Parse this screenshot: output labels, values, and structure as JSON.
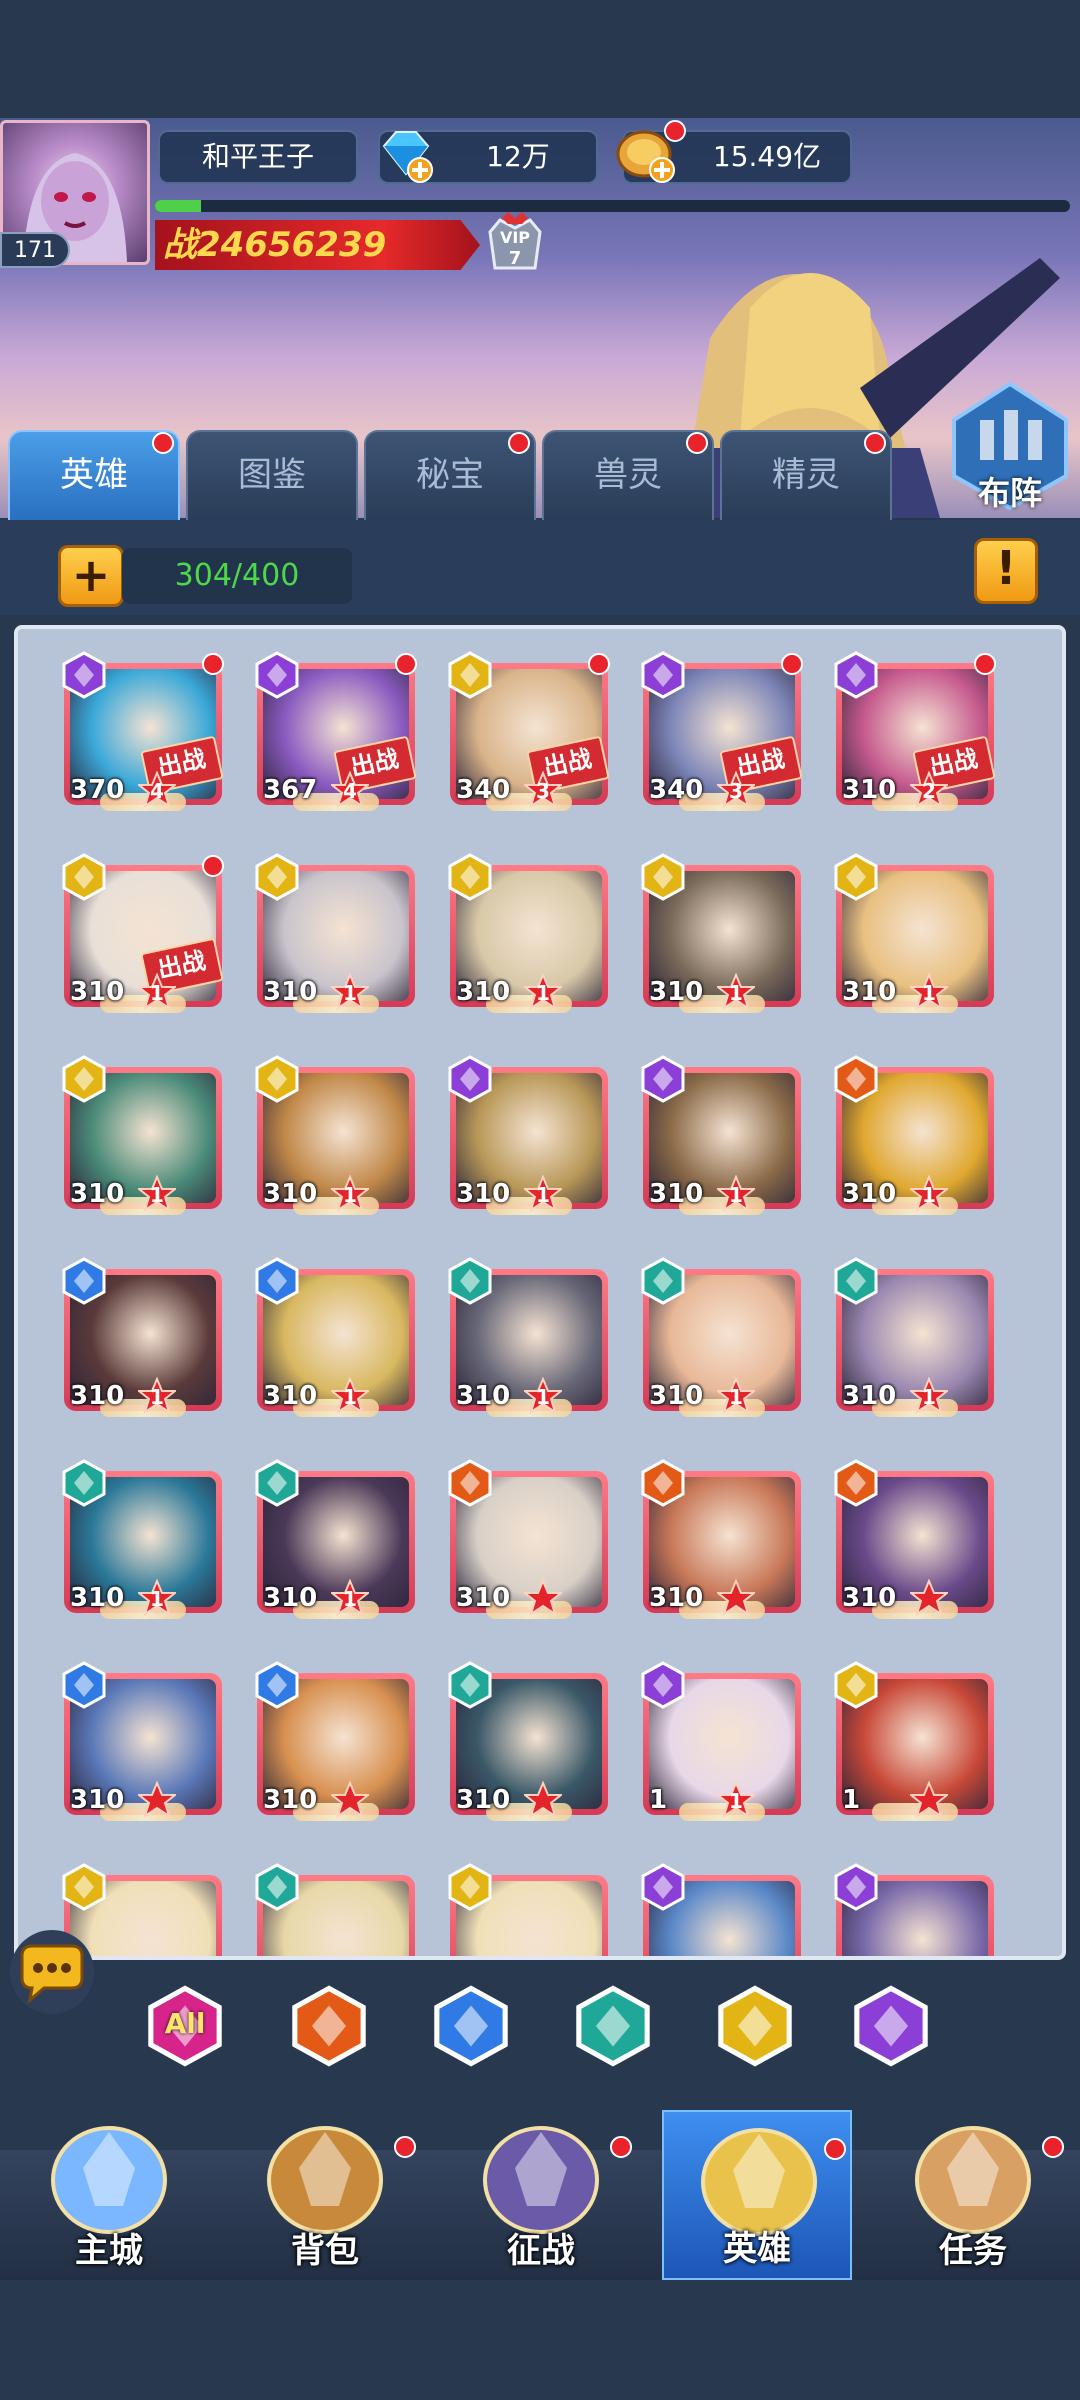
{
  "player": {
    "name": "和平王子",
    "level": "171",
    "gems": "12万",
    "gold": "15.49亿",
    "power": "24656239",
    "power_prefix": "战",
    "vip": "7",
    "vip_label": "VIP",
    "xp_progress": 0.05
  },
  "tabs": [
    {
      "label": "英雄",
      "active": true,
      "dot": true
    },
    {
      "label": "图鉴",
      "active": false,
      "dot": false
    },
    {
      "label": "秘宝",
      "active": false,
      "dot": true
    },
    {
      "label": "兽灵",
      "active": false,
      "dot": true
    },
    {
      "label": "精灵",
      "active": false,
      "dot": true
    }
  ],
  "formation_label": "布阵",
  "capacity": "304/400",
  "deploy_label": "出战",
  "heroes": [
    {
      "level": "370",
      "stars": "4",
      "element": "purple",
      "deployed": true,
      "dot": true,
      "hue": "#3aa8d8"
    },
    {
      "level": "367",
      "stars": "4",
      "element": "purple",
      "deployed": true,
      "dot": true,
      "hue": "#8a5bc0"
    },
    {
      "level": "340",
      "stars": "3",
      "element": "yellow",
      "deployed": true,
      "dot": true,
      "hue": "#d9b48a"
    },
    {
      "level": "340",
      "stars": "3",
      "element": "purple",
      "deployed": true,
      "dot": true,
      "hue": "#7d86b8"
    },
    {
      "level": "310",
      "stars": "2",
      "element": "purple",
      "deployed": true,
      "dot": true,
      "hue": "#c65a8e"
    },
    {
      "level": "310",
      "stars": "1",
      "element": "yellow",
      "deployed": true,
      "dot": true,
      "hue": "#e8e0d8"
    },
    {
      "level": "310",
      "stars": "1",
      "element": "yellow",
      "deployed": false,
      "dot": false,
      "hue": "#c9c4cc"
    },
    {
      "level": "310",
      "stars": "1",
      "element": "yellow",
      "deployed": false,
      "dot": false,
      "hue": "#d8c8a8"
    },
    {
      "level": "310",
      "stars": "1",
      "element": "yellow",
      "deployed": false,
      "dot": false,
      "hue": "#7a6a5a"
    },
    {
      "level": "310",
      "stars": "1",
      "element": "yellow",
      "deployed": false,
      "dot": false,
      "hue": "#e8c080"
    },
    {
      "level": "310",
      "stars": "1",
      "element": "yellow",
      "deployed": false,
      "dot": false,
      "hue": "#4a8a78"
    },
    {
      "level": "310",
      "stars": "1",
      "element": "yellow",
      "deployed": false,
      "dot": false,
      "hue": "#c08848"
    },
    {
      "level": "310",
      "stars": "1",
      "element": "purple",
      "deployed": false,
      "dot": false,
      "hue": "#b89858"
    },
    {
      "level": "310",
      "stars": "1",
      "element": "purple",
      "deployed": false,
      "dot": false,
      "hue": "#8a6a48"
    },
    {
      "level": "310",
      "stars": "1",
      "element": "orange",
      "deployed": false,
      "dot": false,
      "hue": "#e0a830"
    },
    {
      "level": "310",
      "stars": "1",
      "element": "blue",
      "deployed": false,
      "dot": false,
      "hue": "#5a3a3a"
    },
    {
      "level": "310",
      "stars": "1",
      "element": "blue",
      "deployed": false,
      "dot": false,
      "hue": "#d8b860"
    },
    {
      "level": "310",
      "stars": "1",
      "element": "teal",
      "deployed": false,
      "dot": false,
      "hue": "#686878"
    },
    {
      "level": "310",
      "stars": "1",
      "element": "teal",
      "deployed": false,
      "dot": false,
      "hue": "#e8b898"
    },
    {
      "level": "310",
      "stars": "1",
      "element": "teal",
      "deployed": false,
      "dot": false,
      "hue": "#9a88b0"
    },
    {
      "level": "310",
      "stars": "1",
      "element": "teal",
      "deployed": false,
      "dot": false,
      "hue": "#2a7898"
    },
    {
      "level": "310",
      "stars": "1",
      "element": "teal",
      "deployed": false,
      "dot": false,
      "hue": "#4a3858"
    },
    {
      "level": "310",
      "stars": "",
      "element": "orange",
      "deployed": false,
      "dot": false,
      "hue": "#d8d0c8"
    },
    {
      "level": "310",
      "stars": "",
      "element": "orange",
      "deployed": false,
      "dot": false,
      "hue": "#c87858"
    },
    {
      "level": "310",
      "stars": "",
      "element": "orange",
      "deployed": false,
      "dot": false,
      "hue": "#6a4a8a"
    },
    {
      "level": "310",
      "stars": "",
      "element": "blue",
      "deployed": false,
      "dot": false,
      "hue": "#5a78b8"
    },
    {
      "level": "310",
      "stars": "",
      "element": "blue",
      "deployed": false,
      "dot": false,
      "hue": "#d89050"
    },
    {
      "level": "310",
      "stars": "",
      "element": "teal",
      "deployed": false,
      "dot": false,
      "hue": "#3a5868"
    },
    {
      "level": "1",
      "stars": "1",
      "element": "purple",
      "deployed": false,
      "dot": false,
      "hue": "#e8d8e8"
    },
    {
      "level": "1",
      "stars": "",
      "element": "yellow",
      "deployed": false,
      "dot": false,
      "hue": "#c84838"
    },
    {
      "level": "",
      "stars": "",
      "element": "yellow",
      "deployed": false,
      "dot": false,
      "hue": "#f0e0b8"
    },
    {
      "level": "",
      "stars": "",
      "element": "teal",
      "deployed": false,
      "dot": false,
      "hue": "#e8d8a8"
    },
    {
      "level": "",
      "stars": "",
      "element": "yellow",
      "deployed": false,
      "dot": false,
      "hue": "#f0e0b8"
    },
    {
      "level": "",
      "stars": "",
      "element": "purple",
      "deployed": false,
      "dot": false,
      "hue": "#5a88c8"
    },
    {
      "level": "",
      "stars": "",
      "element": "purple",
      "deployed": false,
      "dot": false,
      "hue": "#7868a8"
    }
  ],
  "element_colors": {
    "purple": "#8b3fd6",
    "yellow": "#e2b514",
    "blue": "#2f7ae5",
    "teal": "#1fa898",
    "orange": "#e35a17"
  },
  "filters": [
    {
      "label": "All",
      "element": "all"
    },
    {
      "label": "",
      "element": "orange"
    },
    {
      "label": "",
      "element": "blue"
    },
    {
      "label": "",
      "element": "teal"
    },
    {
      "label": "",
      "element": "yellow"
    },
    {
      "label": "",
      "element": "purple"
    }
  ],
  "nav": [
    {
      "label": "主城",
      "active": false,
      "dot": false,
      "icon": "castle-icon"
    },
    {
      "label": "背包",
      "active": false,
      "dot": true,
      "icon": "chest-icon"
    },
    {
      "label": "征战",
      "active": false,
      "dot": true,
      "icon": "portal-icon"
    },
    {
      "label": "英雄",
      "active": true,
      "dot": true,
      "icon": "helmet-icon"
    },
    {
      "label": "任务",
      "active": false,
      "dot": true,
      "icon": "scroll-icon"
    }
  ]
}
